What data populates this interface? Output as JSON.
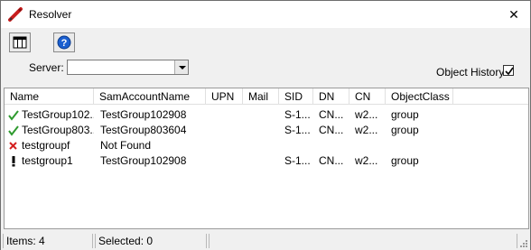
{
  "window": {
    "title": "Resolver",
    "close_glyph": "✕"
  },
  "toolbar": {
    "columns_icon": "columns-icon",
    "help_icon": "help-icon"
  },
  "server": {
    "label": "Server:",
    "value": ""
  },
  "object_history": {
    "label": "Object History",
    "checked": true
  },
  "table": {
    "columns": [
      "Name",
      "SamAccountName",
      "UPN",
      "Mail",
      "SID",
      "DN",
      "CN",
      "ObjectClass"
    ],
    "rows": [
      {
        "status": "ok",
        "name": "TestGroup102...",
        "sam": "TestGroup102908",
        "upn": "",
        "mail": "",
        "sid": "S-1...",
        "dn": "CN...",
        "cn": "w2...",
        "objectclass": "group"
      },
      {
        "status": "ok",
        "name": "TestGroup803...",
        "sam": "TestGroup803604",
        "upn": "",
        "mail": "",
        "sid": "S-1...",
        "dn": "CN...",
        "cn": "w2...",
        "objectclass": "group"
      },
      {
        "status": "error",
        "name": "testgroupf",
        "sam": "Not Found",
        "upn": "",
        "mail": "",
        "sid": "",
        "dn": "",
        "cn": "",
        "objectclass": ""
      },
      {
        "status": "warning",
        "name": "testgroup1",
        "sam": "TestGroup102908",
        "upn": "",
        "mail": "",
        "sid": "S-1...",
        "dn": "CN...",
        "cn": "w2...",
        "objectclass": "group"
      }
    ]
  },
  "statusbar": {
    "items": "Items: 4",
    "selected": "Selected: 0"
  },
  "colors": {
    "ok": "#2e9a2e",
    "error": "#d42020",
    "warning": "#000000",
    "help_blue": "#1a5fd0"
  }
}
